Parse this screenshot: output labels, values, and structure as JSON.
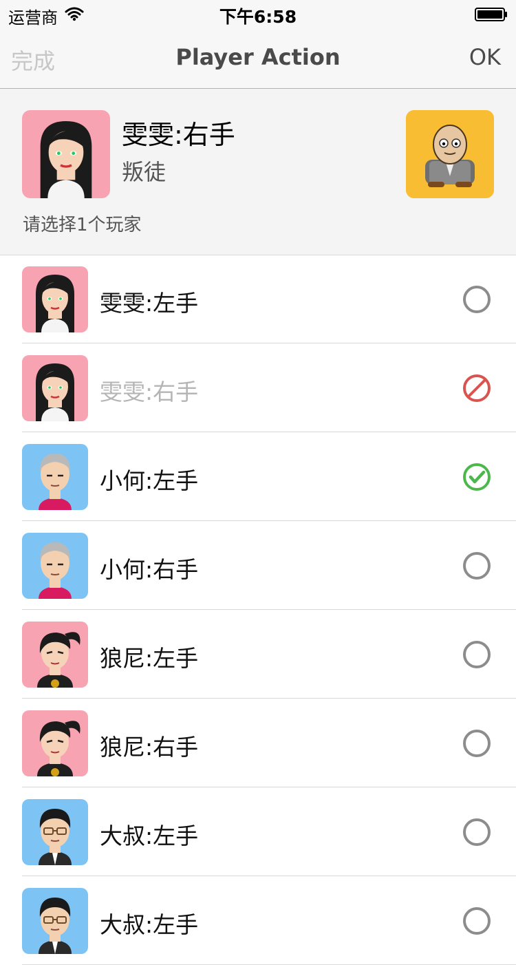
{
  "status_bar": {
    "carrier": "运营商",
    "time": "下午6:58"
  },
  "nav": {
    "left_label": "完成",
    "title": "Player Action",
    "right_label": "OK"
  },
  "header": {
    "player_name": "雯雯:右手",
    "role": "叛徒",
    "hint": "请选择1个玩家"
  },
  "players": [
    {
      "label": "雯雯:左手",
      "avatar": "girl",
      "state": "unselected"
    },
    {
      "label": "雯雯:右手",
      "avatar": "girl",
      "state": "disabled"
    },
    {
      "label": "小何:左手",
      "avatar": "grayhair",
      "state": "selected"
    },
    {
      "label": "小何:右手",
      "avatar": "grayhair",
      "state": "unselected"
    },
    {
      "label": "狼尼:左手",
      "avatar": "ponytail",
      "state": "unselected"
    },
    {
      "label": "狼尼:右手",
      "avatar": "ponytail",
      "state": "unselected"
    },
    {
      "label": "大叔:左手",
      "avatar": "glasses",
      "state": "unselected"
    },
    {
      "label": "大叔:左手",
      "avatar": "glasses",
      "state": "unselected"
    }
  ],
  "colors": {
    "pink_avatar_bg": "#f8a3b2",
    "blue_avatar_bg": "#7dc4f5",
    "role_bg": "#f9bd33",
    "selected": "#4cb84c",
    "disabled": "#d9534f",
    "unselected": "#8c8c8c"
  }
}
